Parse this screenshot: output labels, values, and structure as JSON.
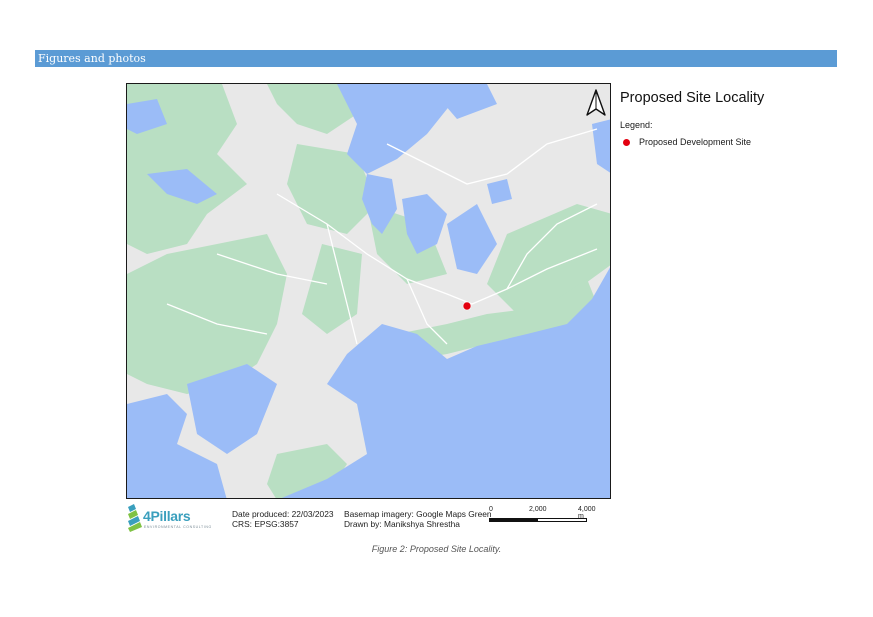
{
  "section": {
    "heading": "Figures and photos"
  },
  "map": {
    "title": "Proposed Site Locality",
    "legend_heading": "Legend:",
    "legend_items": [
      {
        "label": "Proposed Development Site",
        "color": "#e3000f"
      }
    ],
    "north_arrow_icon": "north-arrow-icon",
    "colors": {
      "water": "#9bbcf7",
      "land": "#e8e8e8",
      "parks": "#b9dfc3",
      "roads": "#ffffff",
      "site": "#e3000f"
    }
  },
  "footer": {
    "logo_name": "4Pillars",
    "logo_tagline": "ENVIRONMENTAL CONSULTING",
    "date_produced": "Date produced: 22/03/2023",
    "crs": "CRS: EPSG:3857",
    "basemap": "Basemap imagery: Google Maps Green",
    "drawn_by": "Drawn by: Manikshya Shrestha",
    "scale": {
      "labels": [
        "0",
        "2,000",
        "4,000 m"
      ]
    }
  },
  "caption": "Figure 2: Proposed Site Locality."
}
